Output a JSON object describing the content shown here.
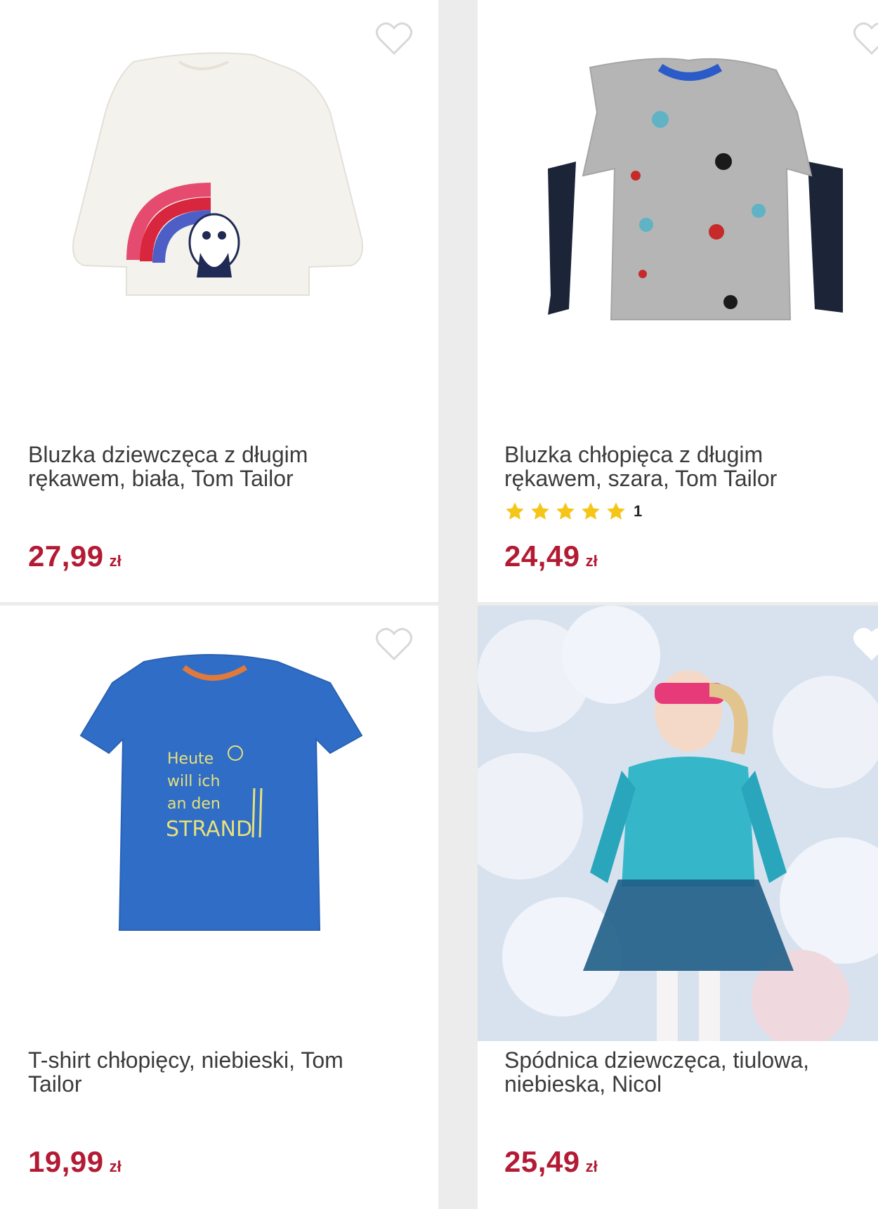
{
  "products": [
    {
      "title": "Bluzka dziewczęca z długim rękawem, biała, Tom Tailor",
      "price": "27,99",
      "currency": "zł",
      "image_icon": "white-longsleeve-panda-rainbow",
      "favorite_icon": "heart-outline-icon"
    },
    {
      "title": "Bluzka chłopięca z długim rękawem, szara, Tom Tailor",
      "price": "24,49",
      "currency": "zł",
      "rating_count": "1",
      "rating_stars": 5,
      "image_icon": "grey-longsleeve-navy-sleeves",
      "favorite_icon": "heart-outline-icon"
    },
    {
      "title": "T-shirt chłopięcy, niebieski, Tom Tailor",
      "price": "19,99",
      "currency": "zł",
      "image_icon": "blue-tshirt-strand",
      "favorite_icon": "heart-outline-icon"
    },
    {
      "title": "Spódnica dziewczęca, tiulowa, niebieska, Nicol",
      "price": "25,49",
      "currency": "zł",
      "image_icon": "girl-in-tulle-skirt-photo",
      "favorite_icon": "heart-outline-icon"
    }
  ],
  "tshirt_print": {
    "line1": "Heute",
    "line2": "will ich",
    "line3": "an den",
    "line4": "STRAND"
  },
  "colors": {
    "price": "#b31b34",
    "star": "#f5c518",
    "heart_outline": "#d8d8d8"
  }
}
